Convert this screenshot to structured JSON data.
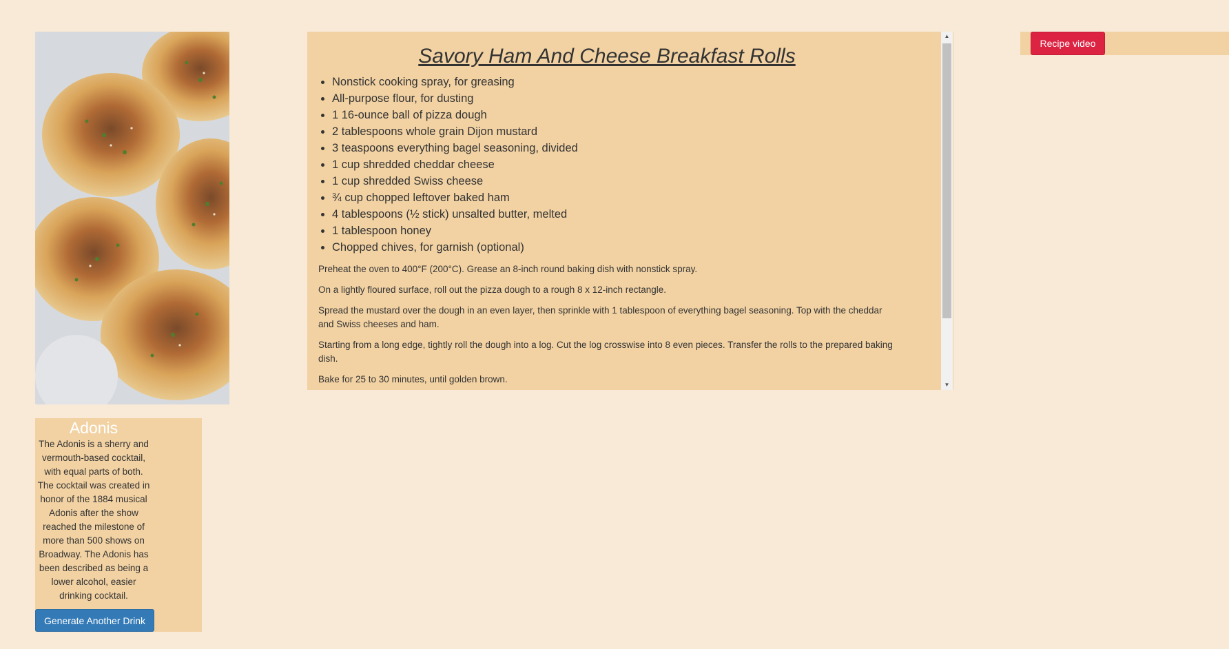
{
  "recipe": {
    "title": "Savory Ham And Cheese Breakfast Rolls",
    "ingredients": [
      "Nonstick cooking spray, for greasing",
      "All-purpose flour, for dusting",
      "1 16-ounce ball of pizza dough",
      "2 tablespoons whole grain Dijon mustard",
      "3 teaspoons everything bagel seasoning, divided",
      "1 cup shredded cheddar cheese",
      "1 cup shredded Swiss cheese",
      "¾ cup chopped leftover baked ham",
      "4 tablespoons (½ stick) unsalted butter, melted",
      "1 tablespoon honey",
      "Chopped chives, for garnish (optional)"
    ],
    "steps": [
      "Preheat the oven to 400°F (200°C). Grease an 8-inch round baking dish with nonstick spray.",
      "On a lightly floured surface, roll out the pizza dough to a rough 8 x 12-inch rectangle.",
      "Spread the mustard over the dough in an even layer, then sprinkle with 1 tablespoon of everything bagel seasoning. Top with the cheddar and Swiss cheeses and ham.",
      "Starting from a long edge, tightly roll the dough into a log. Cut the log crosswise into 8 even pieces. Transfer the rolls to the prepared baking dish.",
      "Bake for 25 to 30 minutes, until golden brown."
    ]
  },
  "drink": {
    "name": "Adonis",
    "description": "The Adonis is a sherry and vermouth-based cocktail, with equal parts of both. The cocktail was created in honor of the 1884 musical Adonis after the show reached the milestone of more than 500 shows on Broadway. The Adonis has been described as being a lower alcohol, easier drinking cocktail.",
    "button_label": "Generate Another Drink"
  },
  "video": {
    "button_label": "Recipe video"
  },
  "colors": {
    "page_bg": "#f8ead6",
    "panel_bg": "#f2d2a3",
    "primary_button": "#337ab7",
    "danger_button": "#dc2342"
  }
}
